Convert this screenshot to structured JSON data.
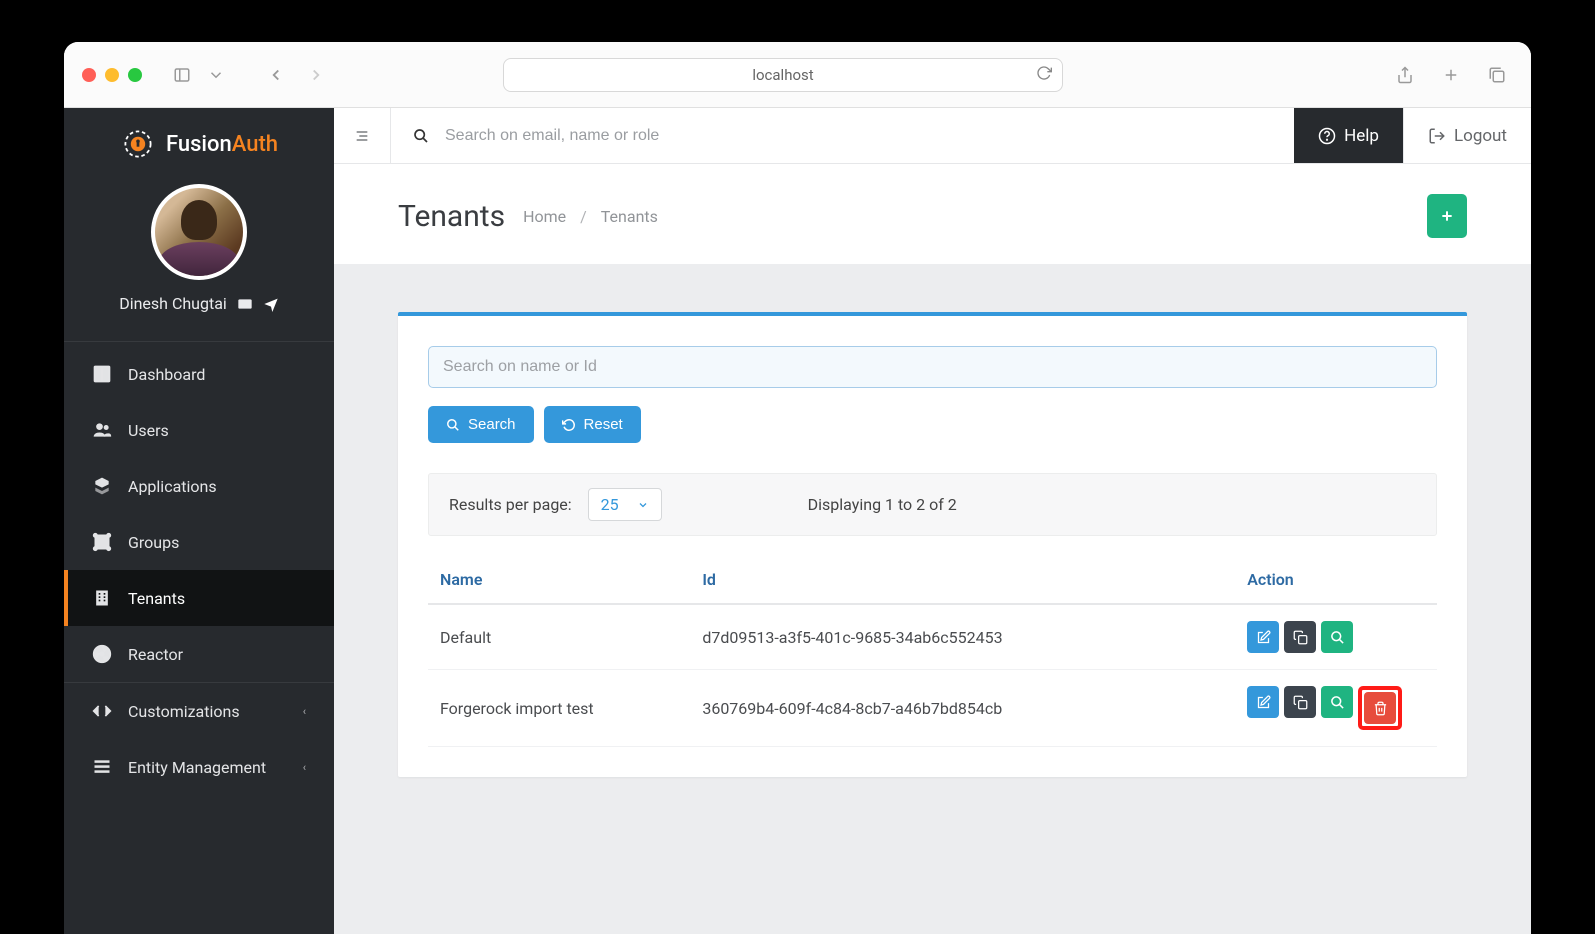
{
  "browser": {
    "url": "localhost"
  },
  "logo": {
    "fusion": "Fusion",
    "auth": "Auth"
  },
  "user": {
    "name": "Dinesh Chugtai"
  },
  "nav": {
    "dashboard": "Dashboard",
    "users": "Users",
    "applications": "Applications",
    "groups": "Groups",
    "tenants": "Tenants",
    "reactor": "Reactor",
    "customizations": "Customizations",
    "entity_management": "Entity Management"
  },
  "topbar": {
    "search_placeholder": "Search on email, name or role",
    "help": "Help",
    "logout": "Logout"
  },
  "page": {
    "title": "Tenants",
    "breadcrumb_home": "Home",
    "breadcrumb_current": "Tenants"
  },
  "search": {
    "placeholder": "Search on name or Id",
    "search_btn": "Search",
    "reset_btn": "Reset"
  },
  "pagination": {
    "label": "Results per page:",
    "per_page": "25",
    "display": "Displaying 1 to 2 of 2"
  },
  "table": {
    "col_name": "Name",
    "col_id": "Id",
    "col_action": "Action",
    "rows": [
      {
        "name": "Default",
        "id": "d7d09513-a3f5-401c-9685-34ab6c552453",
        "deletable": false
      },
      {
        "name": "Forgerock import test",
        "id": "360769b4-609f-4c84-8cb7-a46b7bd854cb",
        "deletable": true
      }
    ]
  }
}
